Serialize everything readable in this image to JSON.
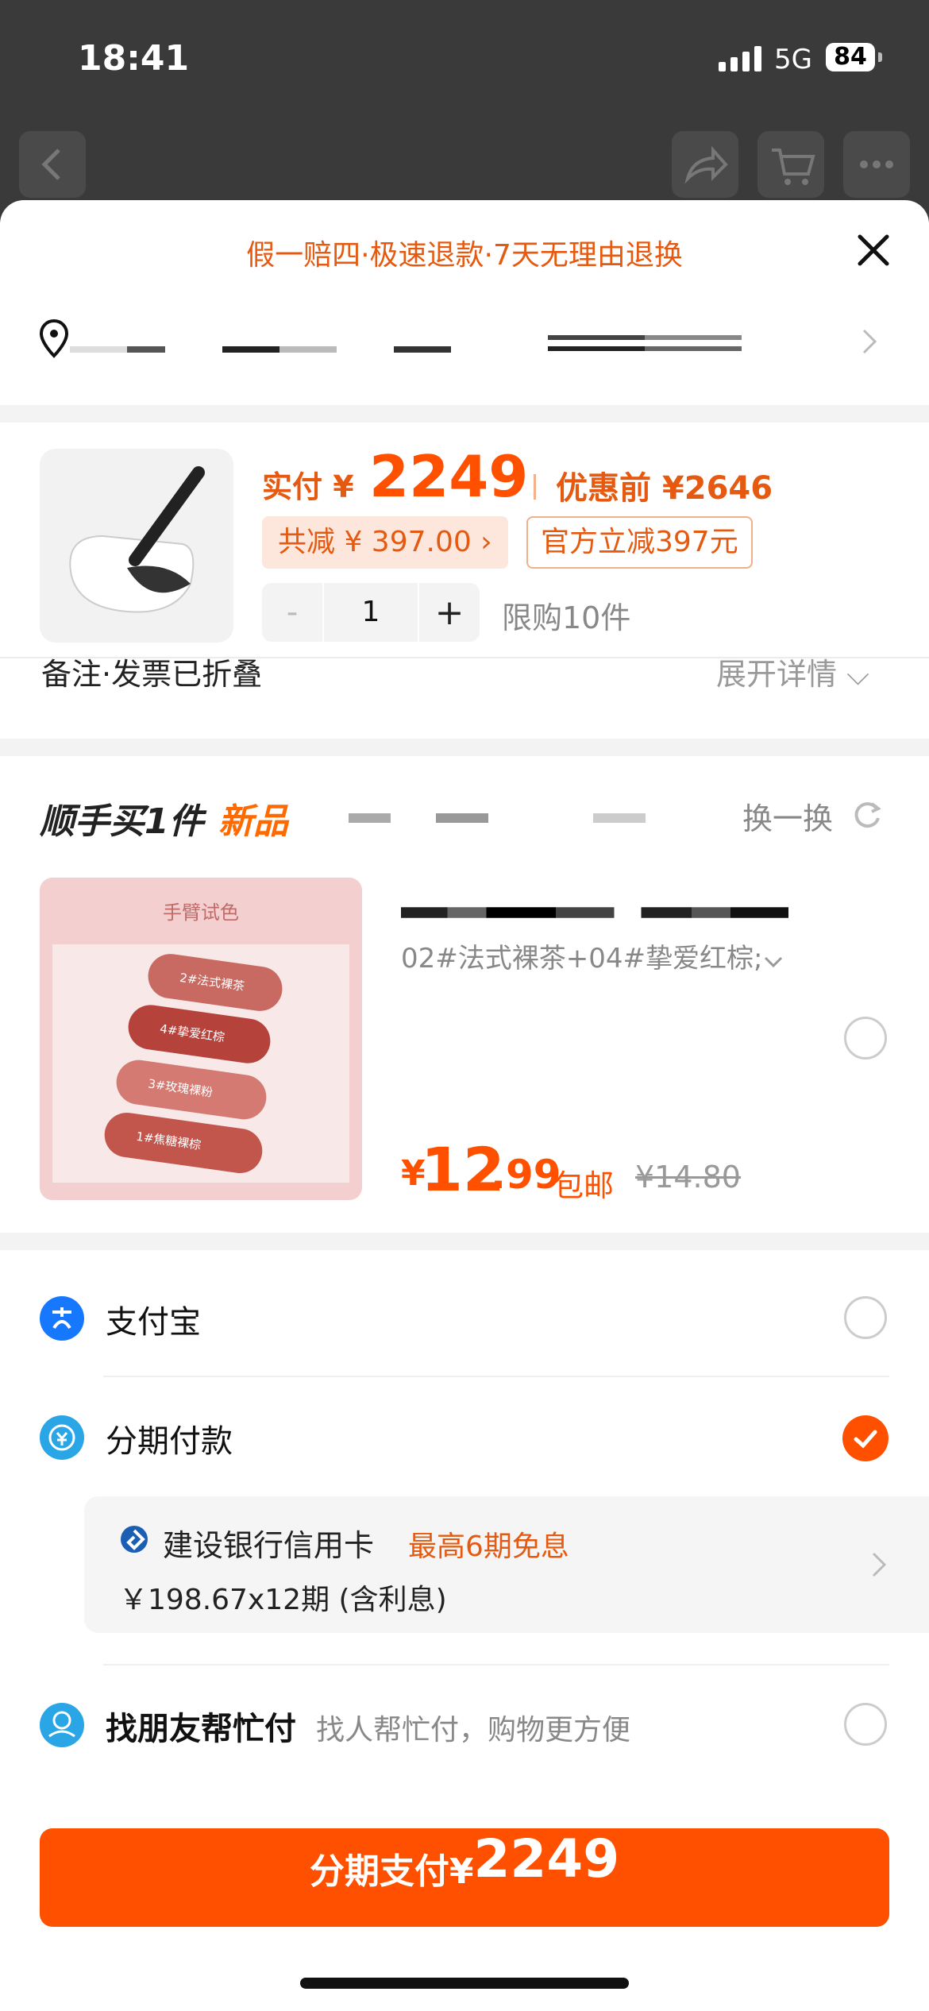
{
  "status_bar": {
    "time": "18:41",
    "network": "5G",
    "battery": "84"
  },
  "sheet": {
    "promo": "假一赔四·极速退款·7天无理由退换",
    "close_icon": "close-icon",
    "address_icon": "location-pin-icon"
  },
  "product": {
    "paid_label": "实付 ¥",
    "paid_amount": "2249",
    "before_label": "优惠前 ¥2646",
    "save_tag": "共减 ¥ 397.00 ›",
    "official_tag": "官方立减397元",
    "qty_minus": "-",
    "quantity": "1",
    "qty_plus": "+",
    "limit": "限购10件",
    "note": "备注·发票已折叠",
    "expand": "展开详情 ⌵"
  },
  "recommend": {
    "title": "顺手买1件",
    "tag": "新品",
    "swap": "换一换",
    "image_title": "手臂试色",
    "swatches": [
      "2#法式裸茶",
      "4#挚爱红棕",
      "3#玫瑰裸粉",
      "1#焦糖裸棕"
    ],
    "variant": "02#法式裸茶+04#挚爱红棕;",
    "price_symbol": "¥",
    "price_int": "12",
    "price_dec": ".99",
    "shipping": "包邮",
    "original_price": "¥14.80"
  },
  "payment": {
    "alipay": "支付宝",
    "installment": "分期付款",
    "bank": "建设银行信用卡",
    "bank_promo": "最高6期免息",
    "plan": "￥198.67x12期 (含利息)",
    "friend": "找朋友帮忙付",
    "friend_sub": "找人帮忙付，购物更方便",
    "button_label": "分期支付¥",
    "button_amount": "2249"
  },
  "colors": {
    "accent": "#ff5000",
    "promo_text": "#e55a10",
    "alipay_blue": "#1677ff"
  }
}
